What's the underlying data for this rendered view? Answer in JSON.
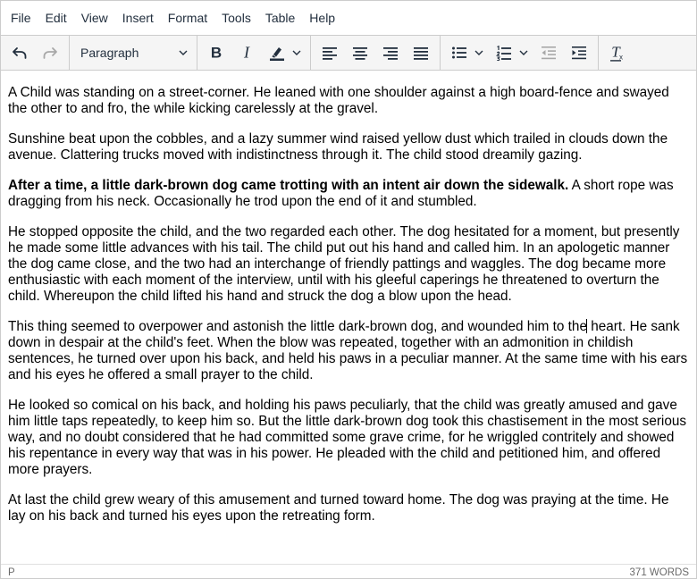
{
  "menubar": {
    "items": [
      "File",
      "Edit",
      "View",
      "Insert",
      "Format",
      "Tools",
      "Table",
      "Help"
    ]
  },
  "toolbar": {
    "block_format": "Paragraph",
    "icons": {
      "undo": "undo-icon",
      "redo": "redo-icon",
      "bold": "bold-icon",
      "italic": "italic-icon",
      "highlight": "highlight-icon",
      "align_left": "align-left-icon",
      "align_center": "align-center-icon",
      "align_right": "align-right-icon",
      "justify": "justify-icon",
      "bullet_list": "bullet-list-icon",
      "numbered_list": "numbered-list-icon",
      "outdent": "outdent-icon",
      "indent": "indent-icon",
      "clear_formatting": "clear-formatting-icon"
    },
    "highlight_color": "#222f3e"
  },
  "document": {
    "p1": "A Child was standing on a street-corner. He leaned with one shoulder against a high board-fence and swayed the other to and fro, the while kicking carelessly at the gravel.",
    "p2": "Sunshine beat upon the cobbles, and a lazy summer wind raised yellow dust which trailed in clouds down the avenue. Clattering trucks moved with indistinctness through it. The child stood dreamily gazing.",
    "p3_bold": "After a time, a little dark-brown dog came trotting with an intent air down the sidewalk.",
    "p3_rest": " A short rope was dragging from his neck. Occasionally he trod upon the end of it and stumbled.",
    "p4": "He stopped opposite the child, and the two regarded each other. The dog hesitated for a moment, but presently he made some little advances with his tail. The child put out his hand and called him. In an apologetic manner the dog came close, and the two had an interchange of friendly pattings and waggles. The dog became more enthusiastic with each moment of the interview, until with his gleeful caperings he threatened to overturn the child. Whereupon the child lifted his hand and struck the dog a blow upon the head.",
    "p5_before_caret": "This thing seemed to overpower and astonish the little dark-brown dog, and wounded him to the",
    "p5_after_caret": " heart. He sank down in despair at the child's feet. When the blow was repeated, together with an admonition in childish sentences, he turned over upon his back, and held his paws in a peculiar manner. At the same time with his ears and his eyes he offered a small prayer to the child.",
    "p6": "He looked so comical on his back, and holding his paws peculiarly, that the child was greatly amused and gave him little taps repeatedly, to keep him so. But the little dark-brown dog took this chastisement in the most serious way, and no doubt considered that he had committed some grave crime, for he wriggled contritely and showed his repentance in every way that was in his power. He pleaded with the child and petitioned him, and offered more prayers.",
    "p7": "At last the child grew weary of this amusement and turned toward home. The dog was praying at the time. He lay on his back and turned his eyes upon the retreating form."
  },
  "statusbar": {
    "path": "P",
    "word_count": "371 WORDS"
  }
}
